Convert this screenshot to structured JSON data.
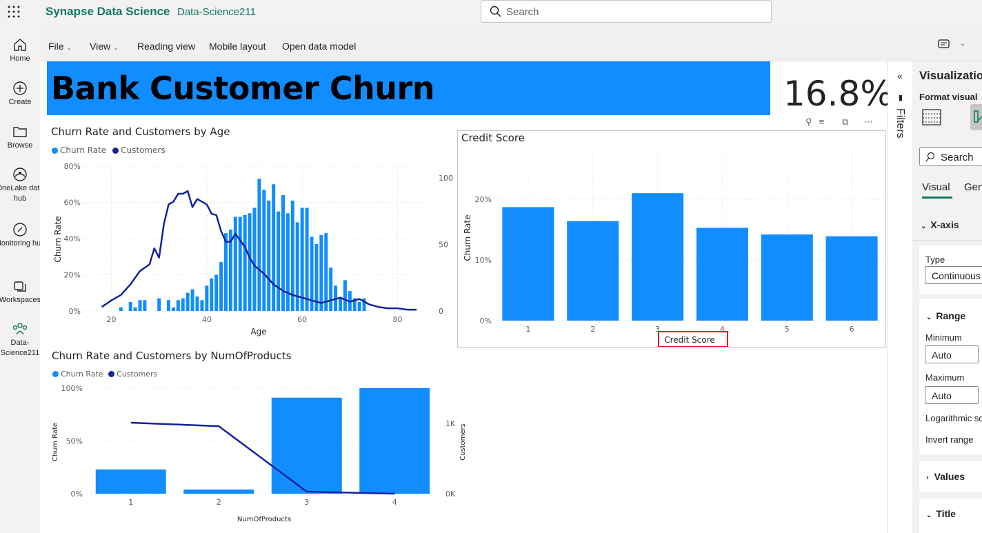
{
  "app": {
    "name": "Synapse Data Science",
    "workspace": "Data-Science211"
  },
  "search": {
    "placeholder": "Search"
  },
  "nav": {
    "items": [
      {
        "label": "Home",
        "icon": "home-icon"
      },
      {
        "label": "Create",
        "icon": "plus-circle-icon"
      },
      {
        "label": "Browse",
        "icon": "folder-icon"
      },
      {
        "label": "OneLake data hub",
        "icon": "onelake-icon"
      },
      {
        "label": "Monitoring hub",
        "icon": "monitoring-icon"
      },
      {
        "label": "Workspaces",
        "icon": "workspaces-icon"
      },
      {
        "label": "Data-Science211",
        "icon": "people-icon"
      }
    ]
  },
  "ribbon": {
    "file": "File",
    "view": "View",
    "reading": "Reading view",
    "mobile": "Mobile layout",
    "model": "Open data model"
  },
  "report": {
    "banner_title": "Bank Customer Churn",
    "kpi_value": "16.8%"
  },
  "visuals": {
    "age": {
      "title": "Churn Rate and Customers by Age"
    },
    "credit": {
      "title": "Credit Score"
    },
    "products": {
      "title": "Churn Rate and Customers by NumOfProducts"
    }
  },
  "filters": {
    "label": "Filters"
  },
  "viz_pane": {
    "title": "Visualizations",
    "subtitle": "Format visual",
    "search_placeholder": "Search",
    "tab_visual": "Visual",
    "tab_general": "General",
    "xaxis": "X-axis",
    "type_label": "Type",
    "type_value": "Continuous",
    "range": "Range",
    "minimum": "Minimum",
    "minimum_value": "Auto",
    "maximum": "Maximum",
    "maximum_value": "Auto",
    "log_scale": "Logarithmic scale",
    "invert_range": "Invert range",
    "values": "Values",
    "title_section": "Title"
  },
  "colors": {
    "churn_rate": "#118dff",
    "customers": "#12239e",
    "brand": "#117865"
  },
  "chart_data": [
    {
      "type": "bar",
      "title": "Churn Rate and Customers by Age",
      "legend": [
        "Churn Rate",
        "Customers"
      ],
      "xlabel": "Age",
      "ylabel": "Churn Rate",
      "xlim": [
        18,
        84
      ],
      "ylim": [
        0,
        0.8
      ],
      "y2lim": [
        0,
        100
      ],
      "x_ticks": [
        20,
        40,
        60,
        80
      ],
      "y_ticks": [
        "0%",
        "20%",
        "40%",
        "60%",
        "80%"
      ],
      "y2_ticks": [
        "0",
        "50",
        "100"
      ],
      "churn_rate": {
        "x": [
          22,
          24,
          25,
          26,
          27,
          30,
          32,
          33,
          34,
          35,
          36,
          37,
          38,
          39,
          40,
          41,
          42,
          43,
          44,
          45,
          46,
          47,
          48,
          49,
          50,
          51,
          52,
          53,
          54,
          55,
          56,
          57,
          58,
          59,
          60,
          61,
          62,
          63,
          64,
          65,
          66,
          67,
          68,
          69,
          70,
          71,
          72,
          73
        ],
        "values": [
          0.02,
          0.05,
          0.02,
          0.06,
          0.06,
          0.07,
          0.06,
          0.02,
          0.06,
          0.07,
          0.1,
          0.12,
          0.08,
          0.06,
          0.14,
          0.18,
          0.2,
          0.27,
          0.43,
          0.45,
          0.52,
          0.52,
          0.53,
          0.54,
          0.57,
          0.73,
          0.67,
          0.61,
          0.7,
          0.55,
          0.64,
          0.54,
          0.61,
          0.49,
          0.57,
          0.57,
          0.41,
          0.37,
          0.42,
          0.43,
          0.24,
          0.14,
          0.07,
          0.17,
          0.11,
          0.07,
          0.05,
          0.07
        ]
      },
      "customers": {
        "x": [
          18,
          20,
          22,
          24,
          26,
          28,
          29,
          30,
          31,
          32,
          33,
          34,
          35,
          36,
          37,
          38,
          39,
          40,
          41,
          42,
          43,
          44,
          45,
          46,
          47,
          48,
          49,
          50,
          52,
          54,
          56,
          58,
          60,
          62,
          64,
          66,
          68,
          70,
          72,
          74,
          76,
          78,
          80,
          82,
          84
        ],
        "values": [
          3,
          8,
          12,
          20,
          30,
          35,
          47,
          40,
          65,
          80,
          82,
          88,
          88,
          90,
          78,
          84,
          82,
          80,
          73,
          72,
          60,
          52,
          52,
          58,
          53,
          48,
          40,
          34,
          28,
          20,
          15,
          12,
          10,
          8,
          6,
          8,
          10,
          7,
          9,
          5,
          3,
          2,
          2,
          1,
          1
        ]
      }
    },
    {
      "type": "bar",
      "title": "Credit Score",
      "xlabel": "Credit Score",
      "ylabel": "Churn Rate",
      "categories": [
        "1",
        "2",
        "3",
        "4",
        "5",
        "6"
      ],
      "values": [
        0.187,
        0.164,
        0.21,
        0.153,
        0.142,
        0.139
      ],
      "ylim": [
        0,
        0.25
      ],
      "y_ticks": [
        "0%",
        "10%",
        "20%"
      ]
    },
    {
      "type": "bar",
      "title": "Churn Rate and Customers by NumOfProducts",
      "legend": [
        "Churn Rate",
        "Customers"
      ],
      "xlabel": "NumOfProducts",
      "ylabel": "Churn Rate",
      "y2label": "Customers",
      "categories": [
        "1",
        "2",
        "3",
        "4"
      ],
      "churn_rate": [
        0.23,
        0.04,
        0.91,
        1.0
      ],
      "customers": [
        1010,
        960,
        30,
        0
      ],
      "ylim": [
        0,
        1.0
      ],
      "y2lim": [
        0,
        1500
      ],
      "y_ticks": [
        "0%",
        "50%",
        "100%"
      ],
      "y2_ticks": [
        "0K",
        "1K"
      ]
    }
  ]
}
